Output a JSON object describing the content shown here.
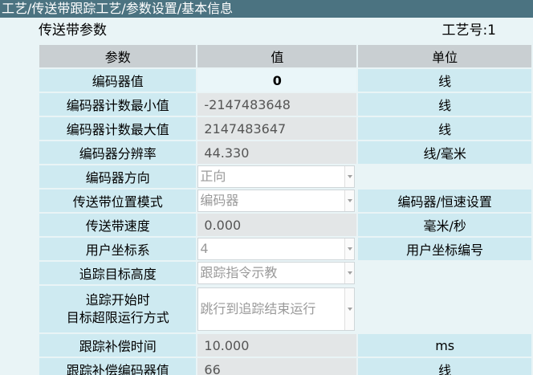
{
  "breadcrumb": "工艺/传送带跟踪工艺/参数设置/基本信息",
  "section_title": "传送带参数",
  "process_no": "工艺号:1",
  "headers": {
    "param": "参数",
    "value": "值",
    "unit": "单位"
  },
  "rows": [
    {
      "name": "编码器值",
      "value": "0",
      "unit": "线"
    },
    {
      "name": "编码器计数最小值",
      "value": "-2147483648",
      "unit": "线"
    },
    {
      "name": "编码器计数最大值",
      "value": "2147483647",
      "unit": "线"
    },
    {
      "name": "编码器分辨率",
      "value": "44.330",
      "unit": "线/毫米"
    },
    {
      "name": "编码器方向",
      "value": "正向",
      "unit": ""
    },
    {
      "name": "传送带位置模式",
      "value": "编码器",
      "unit": "编码器/恒速设置"
    },
    {
      "name": "传送带速度",
      "value": "0.000",
      "unit": "毫米/秒"
    },
    {
      "name": "用户坐标系",
      "value": "4",
      "unit": "用户坐标编号"
    },
    {
      "name": "追踪目标高度",
      "value": "跟踪指令示教",
      "unit": ""
    },
    {
      "name_line1": "追踪开始时",
      "name_line2": "目标超限运行方式",
      "value": "跳行到追踪结束运行",
      "unit": ""
    },
    {
      "name": "跟踪补偿时间",
      "value": "10.000",
      "unit": "ms"
    },
    {
      "name": "跟踪补偿编码器值",
      "value": "66",
      "unit": "线"
    }
  ]
}
